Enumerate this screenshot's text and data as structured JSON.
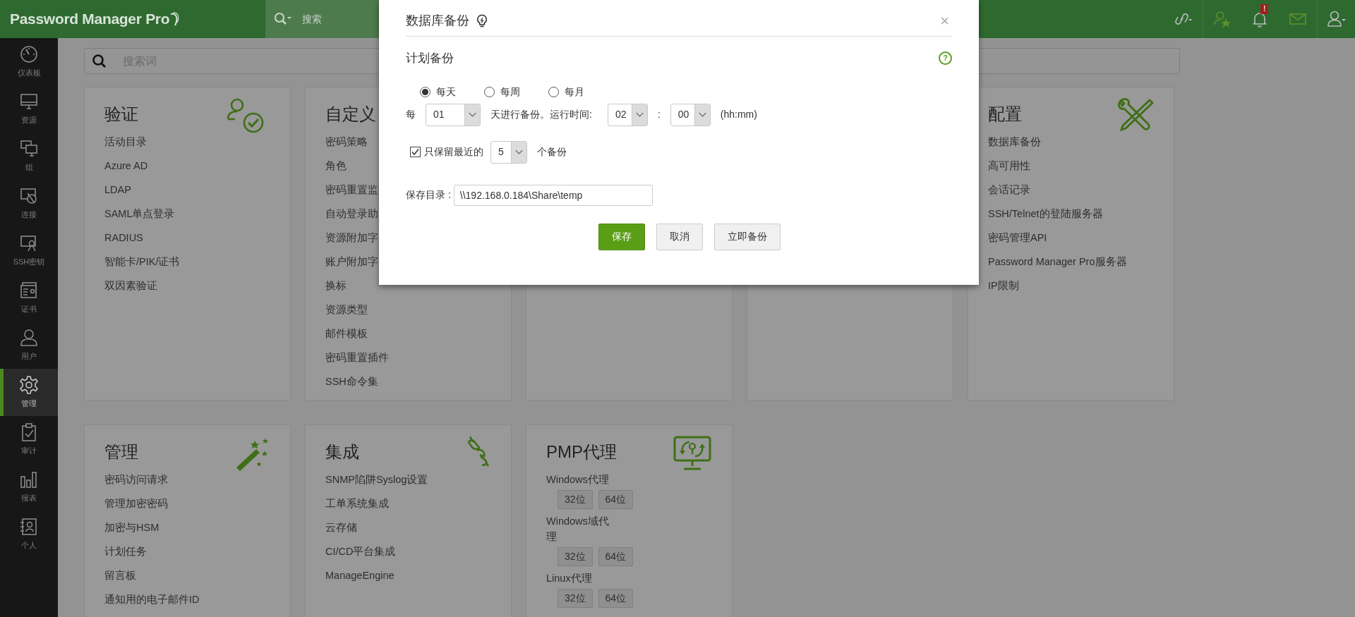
{
  "topbar": {
    "logo": "Password Manager Pro",
    "search_label": "搜索",
    "alert_badge": "!"
  },
  "sidebar": {
    "items": [
      {
        "label": "仪表板",
        "selected": false
      },
      {
        "label": "资源",
        "selected": false
      },
      {
        "label": "组",
        "selected": false
      },
      {
        "label": "连接",
        "selected": false
      },
      {
        "label": "SSH密钥",
        "selected": false
      },
      {
        "label": "证书",
        "selected": false
      },
      {
        "label": "用户",
        "selected": false
      },
      {
        "label": "管理",
        "selected": true
      },
      {
        "label": "审计",
        "selected": false
      },
      {
        "label": "报表",
        "selected": false
      },
      {
        "label": "个人",
        "selected": false
      }
    ]
  },
  "search": {
    "placeholder": "搜索词"
  },
  "cards": [
    {
      "kind": "links",
      "title": "验证",
      "items": [
        "活动目录",
        "Azure AD",
        "LDAP",
        "SAML单点登录",
        "RADIUS",
        "智能卡/PIK/证书",
        "双因素验证"
      ]
    },
    {
      "kind": "links",
      "title": "自定义",
      "items": [
        "密码策略",
        "角色",
        "密码重置监",
        "自动登录助",
        "资源附加字",
        "账户附加字",
        "换标",
        "资源类型",
        "邮件模板",
        "密码重置插件",
        "SSH命令集"
      ]
    },
    {
      "kind": "covered"
    },
    {
      "kind": "covered"
    },
    {
      "kind": "links",
      "title": "配置",
      "items": [
        "数据库备份",
        "高可用性",
        "会话记录",
        "SSH/Telnet的登陆服务器",
        "密码管理API",
        "Password Manager Pro服务器",
        "IP限制"
      ]
    },
    {
      "kind": "links",
      "title": "管理",
      "items": [
        "密码访问请求",
        "管理加密密码",
        "加密与HSM",
        "计划任务",
        "留言板",
        "通知用的电子邮件ID"
      ]
    },
    {
      "kind": "links",
      "title": "集成",
      "items": [
        "SNMP陷阱Syslog设置",
        "工单系统集成",
        "云存储",
        "CI/CD平台集成",
        "ManageEngine"
      ]
    },
    {
      "kind": "agents",
      "title": "PMP代理",
      "groups": [
        {
          "label": "Windows代理",
          "buttons": [
            "32位",
            "64位"
          ]
        },
        {
          "label": "Windows域代理",
          "buttons": [
            "32位",
            "64位"
          ]
        },
        {
          "label": "Linux代理",
          "buttons": [
            "32位",
            "64位"
          ]
        }
      ]
    }
  ],
  "dialog": {
    "title": "数据库备份",
    "close": "×",
    "section": "计划备份",
    "help": "?",
    "frequency": [
      {
        "label": "每天",
        "selected": true
      },
      {
        "label": "每周",
        "selected": false
      },
      {
        "label": "每月",
        "selected": false
      }
    ],
    "every_label": "每",
    "interval": "01",
    "interval_suffix": "天进行备份。运行时间:",
    "hour": "02",
    "time_separator": ":",
    "minute": "00",
    "time_format": "(hh:mm)",
    "keep": {
      "checked": true,
      "label": "只保留最近的",
      "count": "5",
      "suffix": "个备份"
    },
    "directory": {
      "label": "保存目录 :",
      "value": "\\\\192.168.0.184\\Share\\temp"
    },
    "buttons": [
      {
        "label": "保存",
        "kind": "primary"
      },
      {
        "label": "取消",
        "kind": "secondary"
      },
      {
        "label": "立即备份",
        "kind": "secondary"
      }
    ]
  }
}
